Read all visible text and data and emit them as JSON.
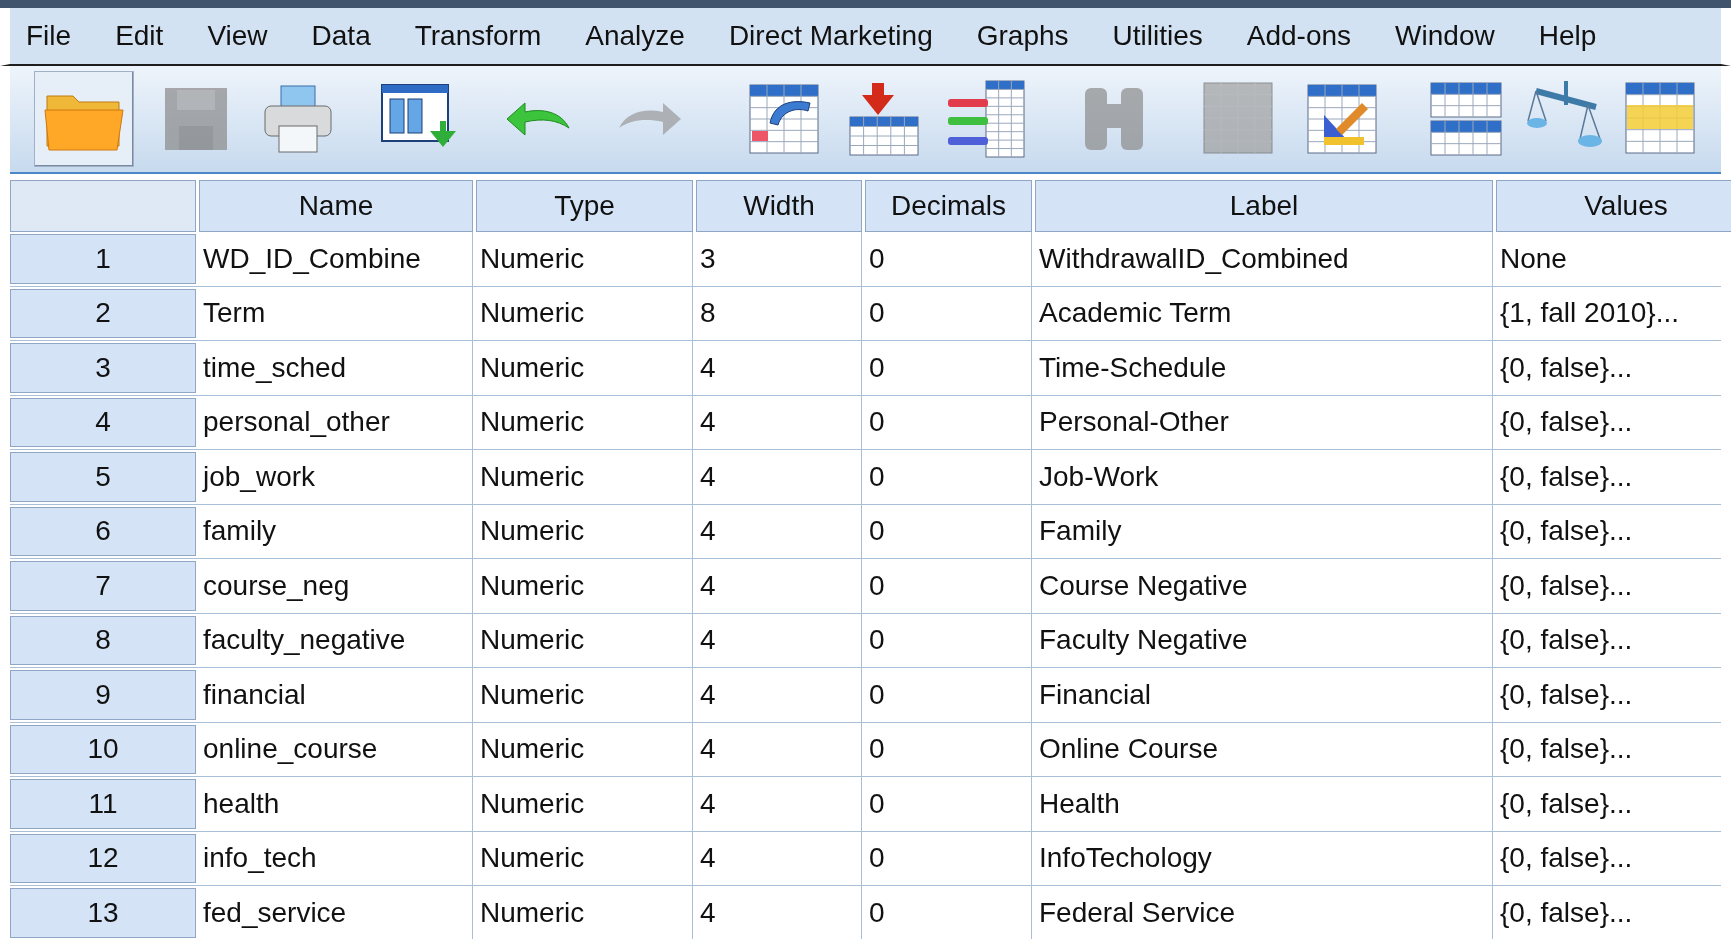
{
  "menu": [
    "File",
    "Edit",
    "View",
    "Data",
    "Transform",
    "Analyze",
    "Direct Marketing",
    "Graphs",
    "Utilities",
    "Add-ons",
    "Window",
    "Help"
  ],
  "toolbar": [
    {
      "kind": "open",
      "disabled": false,
      "selected": true
    },
    {
      "kind": "save",
      "disabled": true,
      "selected": false
    },
    {
      "kind": "print",
      "disabled": false,
      "selected": false
    },
    {
      "kind": "dialog",
      "disabled": false,
      "selected": false
    },
    {
      "kind": "undo",
      "disabled": false,
      "selected": false
    },
    {
      "kind": "redo",
      "disabled": true,
      "selected": false
    },
    {
      "kind": "goto-case",
      "disabled": false,
      "selected": false
    },
    {
      "kind": "insert-cases",
      "disabled": false,
      "selected": false
    },
    {
      "kind": "variables",
      "disabled": false,
      "selected": false
    },
    {
      "kind": "find",
      "disabled": true,
      "selected": false
    },
    {
      "kind": "split",
      "disabled": true,
      "selected": false
    },
    {
      "kind": "chart-builder",
      "disabled": false,
      "selected": false
    },
    {
      "kind": "split-file",
      "disabled": false,
      "selected": false
    },
    {
      "kind": "weight",
      "disabled": false,
      "selected": false
    },
    {
      "kind": "select-cases",
      "disabled": false,
      "selected": false
    }
  ],
  "table": {
    "columns": [
      "Name",
      "Type",
      "Width",
      "Decimals",
      "Label",
      "Values"
    ],
    "rows": [
      {
        "number": "1",
        "cells": [
          "WD_ID_Combine",
          "Numeric",
          "3",
          "0",
          "WithdrawalID_Combined",
          "None"
        ]
      },
      {
        "number": "2",
        "cells": [
          "Term",
          "Numeric",
          "8",
          "0",
          "Academic Term",
          "{1, fall 2010}..."
        ]
      },
      {
        "number": "3",
        "cells": [
          "time_sched",
          "Numeric",
          "4",
          "0",
          "Time-Schedule",
          "{0, false}..."
        ]
      },
      {
        "number": "4",
        "cells": [
          "personal_other",
          "Numeric",
          "4",
          "0",
          "Personal-Other",
          "{0, false}..."
        ]
      },
      {
        "number": "5",
        "cells": [
          "job_work",
          "Numeric",
          "4",
          "0",
          "Job-Work",
          "{0, false}..."
        ]
      },
      {
        "number": "6",
        "cells": [
          "family",
          "Numeric",
          "4",
          "0",
          "Family",
          "{0, false}..."
        ]
      },
      {
        "number": "7",
        "cells": [
          "course_neg",
          "Numeric",
          "4",
          "0",
          "Course Negative",
          "{0, false}..."
        ]
      },
      {
        "number": "8",
        "cells": [
          "faculty_negative",
          "Numeric",
          "4",
          "0",
          "Faculty Negative",
          "{0, false}..."
        ]
      },
      {
        "number": "9",
        "cells": [
          "financial",
          "Numeric",
          "4",
          "0",
          "Financial",
          "{0, false}..."
        ]
      },
      {
        "number": "10",
        "cells": [
          "online_course",
          "Numeric",
          "4",
          "0",
          "Online Course",
          "{0, false}..."
        ]
      },
      {
        "number": "11",
        "cells": [
          "health",
          "Numeric",
          "4",
          "0",
          "Health",
          "{0, false}..."
        ]
      },
      {
        "number": "12",
        "cells": [
          "info_tech",
          "Numeric",
          "4",
          "0",
          "InfoTechology",
          "{0, false}..."
        ]
      },
      {
        "number": "13",
        "cells": [
          "fed_service",
          "Numeric",
          "4",
          "0",
          "Federal Service",
          "{0, false}..."
        ]
      }
    ]
  }
}
